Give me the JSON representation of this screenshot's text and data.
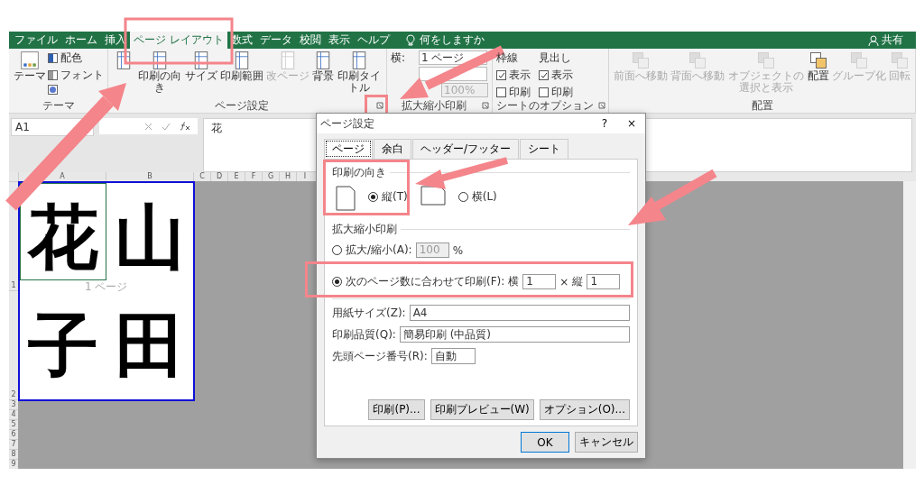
{
  "tabs": [
    {
      "label": "ファイル",
      "selected": false
    },
    {
      "label": "ホーム",
      "selected": false
    },
    {
      "label": "挿入",
      "selected": false
    },
    {
      "label": "ページ レイアウト",
      "selected": true
    },
    {
      "label": "数式",
      "selected": false
    },
    {
      "label": "データ",
      "selected": false
    },
    {
      "label": "校閲",
      "selected": false
    },
    {
      "label": "表示",
      "selected": false
    },
    {
      "label": "ヘルプ",
      "selected": false
    }
  ],
  "tell_me": "何をしますか",
  "share": "共有",
  "ribbon": {
    "theme": {
      "label": "テーマ",
      "large": "テーマ",
      "small": [
        "配色",
        "フォント"
      ]
    },
    "page_setup": {
      "label": "ページ設定",
      "buttons": [
        {
          "disabled": false
        },
        {
          "label": "印刷の向き",
          "disabled": false
        },
        {
          "label": "サイズ",
          "disabled": false
        },
        {
          "label": "印刷範囲",
          "disabled": false
        },
        {
          "label": "改ページ",
          "disabled": true
        },
        {
          "label": "背景",
          "disabled": false
        },
        {
          "label": "印刷タイトル",
          "disabled": false
        }
      ]
    },
    "scale": {
      "label": "拡大縮小印刷",
      "rows": [
        {
          "label": "横:",
          "value": "1 ページ",
          "disabled": false
        },
        {
          "disabled": false
        },
        {
          "value": "100%",
          "disabled": true
        }
      ]
    },
    "sheet_options": {
      "label": "シートのオプション",
      "columns": [
        {
          "heading": "枠線",
          "items": [
            {
              "label": "表示",
              "checked": true
            },
            {
              "label": "印刷",
              "checked": false
            }
          ]
        },
        {
          "heading": "見出し",
          "items": [
            {
              "label": "表示",
              "checked": true
            },
            {
              "label": "印刷",
              "checked": false
            }
          ]
        }
      ]
    },
    "arrange": {
      "label": "配置",
      "buttons": [
        {
          "label": "前面へ移動",
          "disabled": true
        },
        {
          "label": "背面へ移動",
          "disabled": true
        },
        {
          "label": "オブジェクトの選択と表示",
          "disabled": true
        },
        {
          "label": "配置",
          "disabled": false
        },
        {
          "label": "グループ化",
          "disabled": true
        },
        {
          "label": "回転",
          "disabled": true
        }
      ]
    }
  },
  "formula_bar": {
    "name_box": "A1",
    "formula": "花"
  },
  "sheet": {
    "columns": [
      "A",
      "B",
      "C",
      "D",
      "E",
      "F",
      "G",
      "H",
      "I"
    ],
    "rows": [
      "1",
      "2",
      "3",
      "4",
      "5",
      "6",
      "7",
      "8",
      "9"
    ],
    "cells": [
      "花",
      "山",
      "子",
      "田"
    ],
    "page_label": "1 ページ"
  },
  "dialog": {
    "title": "ページ設定",
    "help": "?",
    "close": "×",
    "tabs": [
      {
        "label": "ページ",
        "selected": true
      },
      {
        "label": "余白",
        "selected": false
      },
      {
        "label": "ヘッダー/フッター",
        "selected": false
      },
      {
        "label": "シート",
        "selected": false
      }
    ],
    "orientation": {
      "heading": "印刷の向き",
      "options": [
        {
          "label": "縦(T)",
          "selected": true
        },
        {
          "label": "横(L)",
          "selected": false
        }
      ]
    },
    "scaling": {
      "heading": "拡大縮小印刷",
      "adjust": {
        "label": "拡大/縮小(A):",
        "value": "100",
        "unit": "%",
        "selected": false
      },
      "fit": {
        "label": "次のページ数に合わせて印刷(F):",
        "selected": true,
        "wide_label": "横",
        "wide": "1",
        "times": "×",
        "tall_label": "縦",
        "tall": "1"
      }
    },
    "paper_size": {
      "label": "用紙サイズ(Z):",
      "value": "A4"
    },
    "print_quality": {
      "label": "印刷品質(Q):",
      "value": "簡易印刷 (中品質)"
    },
    "first_page": {
      "label": "先頭ページ番号(R):",
      "value": "自動"
    },
    "buttons": [
      "印刷(P)...",
      "印刷プレビュー(W)",
      "オプション(O)..."
    ],
    "ok": "OK",
    "cancel": "キャンセル"
  }
}
